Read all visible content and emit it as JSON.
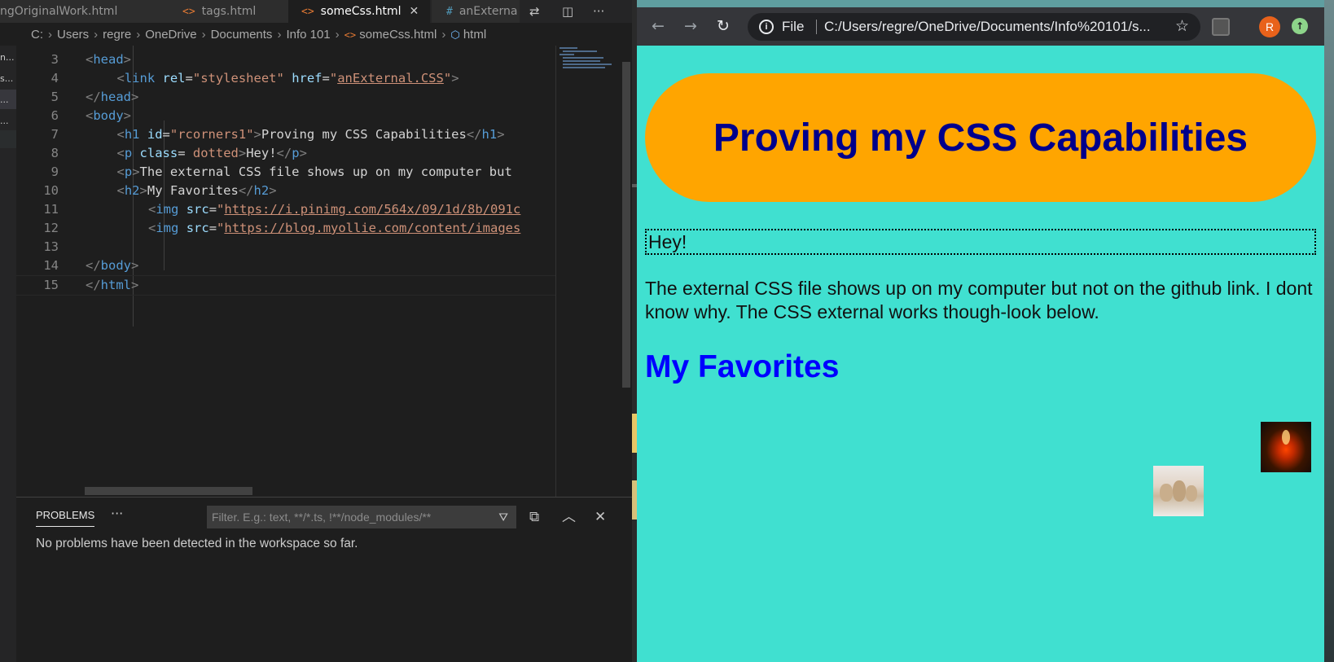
{
  "vscode": {
    "tabs": [
      {
        "label": "ngOriginalWork.html",
        "icon": "html-file-icon",
        "active": false
      },
      {
        "label": "tags.html",
        "icon": "html-file-icon",
        "active": false
      },
      {
        "label": "someCss.html",
        "icon": "html-file-icon",
        "active": true
      },
      {
        "label": "anExterna",
        "icon": "css-file-icon",
        "active": false
      }
    ],
    "breadcrumb": [
      "C:",
      "Users",
      "regre",
      "OneDrive",
      "Documents",
      "Info 101",
      "someCss.html",
      "html"
    ],
    "editor": {
      "lines": [
        {
          "n": "3",
          "tokens": [
            [
              "pun",
              "<"
            ],
            [
              "tag",
              "head"
            ],
            [
              "pun",
              ">"
            ]
          ]
        },
        {
          "n": "4",
          "tokens": [
            [
              "pun",
              "<"
            ],
            [
              "tag",
              "link"
            ],
            [
              "txt",
              " "
            ],
            [
              "attr",
              "rel"
            ],
            [
              "txt",
              "="
            ],
            [
              "str",
              "\"stylesheet\""
            ],
            [
              "txt",
              " "
            ],
            [
              "attr",
              "href"
            ],
            [
              "txt",
              "="
            ],
            [
              "str",
              "\""
            ],
            [
              "link",
              "anExternal.CSS"
            ],
            [
              "str",
              "\""
            ],
            [
              "pun",
              ">"
            ]
          ]
        },
        {
          "n": "5",
          "tokens": [
            [
              "pun",
              "</"
            ],
            [
              "tag",
              "head"
            ],
            [
              "pun",
              ">"
            ]
          ]
        },
        {
          "n": "6",
          "tokens": [
            [
              "pun",
              "<"
            ],
            [
              "tag",
              "body"
            ],
            [
              "pun",
              ">"
            ]
          ]
        },
        {
          "n": "7",
          "tokens": [
            [
              "pun",
              "<"
            ],
            [
              "tag",
              "h1"
            ],
            [
              "txt",
              " "
            ],
            [
              "attr",
              "id"
            ],
            [
              "txt",
              "="
            ],
            [
              "str",
              "\"rcorners1\""
            ],
            [
              "pun",
              ">"
            ],
            [
              "txt",
              "Proving my CSS Capabilities"
            ],
            [
              "pun",
              "</"
            ],
            [
              "tag",
              "h1"
            ],
            [
              "pun",
              ">"
            ]
          ]
        },
        {
          "n": "8",
          "tokens": [
            [
              "pun",
              "<"
            ],
            [
              "tag",
              "p"
            ],
            [
              "txt",
              " "
            ],
            [
              "attr",
              "class"
            ],
            [
              "txt",
              "= "
            ],
            [
              "str",
              "dotted"
            ],
            [
              "pun",
              ">"
            ],
            [
              "txt",
              "Hey!"
            ],
            [
              "pun",
              "</"
            ],
            [
              "tag",
              "p"
            ],
            [
              "pun",
              ">"
            ]
          ]
        },
        {
          "n": "9",
          "tokens": [
            [
              "pun",
              "<"
            ],
            [
              "tag",
              "p"
            ],
            [
              "pun",
              ">"
            ],
            [
              "txt",
              "The external CSS file shows up on my computer but"
            ]
          ]
        },
        {
          "n": "10",
          "tokens": [
            [
              "pun",
              "<"
            ],
            [
              "tag",
              "h2"
            ],
            [
              "pun",
              ">"
            ],
            [
              "txt",
              "My Favorites"
            ],
            [
              "pun",
              "</"
            ],
            [
              "tag",
              "h2"
            ],
            [
              "pun",
              ">"
            ]
          ]
        },
        {
          "n": "11",
          "tokens": [
            [
              "pun",
              "<"
            ],
            [
              "tag",
              "img"
            ],
            [
              "txt",
              " "
            ],
            [
              "attr",
              "src"
            ],
            [
              "txt",
              "="
            ],
            [
              "str",
              "\""
            ],
            [
              "link",
              "https://i.pinimg.com/564x/09/1d/8b/091c"
            ]
          ]
        },
        {
          "n": "12",
          "tokens": [
            [
              "pun",
              "<"
            ],
            [
              "tag",
              "img"
            ],
            [
              "txt",
              " "
            ],
            [
              "attr",
              "src"
            ],
            [
              "txt",
              "="
            ],
            [
              "str",
              "\""
            ],
            [
              "link",
              "https://blog.myollie.com/content/images"
            ]
          ]
        },
        {
          "n": "13",
          "tokens": []
        },
        {
          "n": "14",
          "tokens": [
            [
              "pun",
              "</"
            ],
            [
              "tag",
              "body"
            ],
            [
              "pun",
              ">"
            ]
          ]
        },
        {
          "n": "15",
          "tokens": [
            [
              "pun",
              "</"
            ],
            [
              "tag",
              "html"
            ],
            [
              "pun",
              ">"
            ]
          ]
        }
      ]
    },
    "panel": {
      "tab_label": "PROBLEMS",
      "more": "···",
      "filter_placeholder": "Filter. E.g.: text, **/*.ts, !**/node_modules/**",
      "message": "No problems have been detected in the workspace so far."
    }
  },
  "browser": {
    "scheme": "File",
    "url": "C:/Users/regre/OneDrive/Documents/Info%20101/s...",
    "avatar_letter": "R",
    "page": {
      "h1": "Proving my CSS Capabilities",
      "dotted_p": "Hey!",
      "paragraph": "The external CSS file shows up on my computer but not on the github link. I dont know why. The CSS external works though-look below.",
      "h2": "My Favorites",
      "images": [
        {
          "alt": "lava lamp image",
          "icon": "lava-lamp"
        },
        {
          "alt": "puppies image",
          "icon": "puppies"
        }
      ]
    },
    "colors": {
      "page_bg": "#40e0d0",
      "h1_bg": "#ffa500",
      "h1_text": "#00008b",
      "h2_text": "#0000ff"
    }
  }
}
